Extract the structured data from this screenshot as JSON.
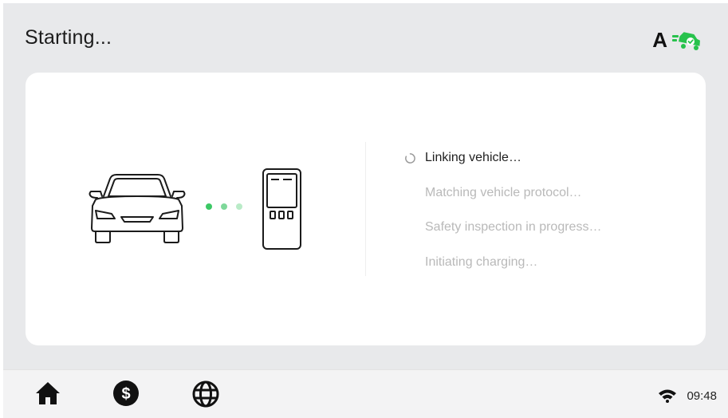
{
  "header": {
    "title": "Starting...",
    "brand_letter": "A",
    "brand_icon": "charging-car-check-icon",
    "brand_color": "#27c24c"
  },
  "connection": {
    "vehicle_icon": "car-icon",
    "charger_icon": "charging-station-icon",
    "dot_colors": [
      "#3cc865",
      "#7ed89a",
      "#b9ebc7"
    ]
  },
  "steps": [
    {
      "label": "Linking vehicle…",
      "state": "active"
    },
    {
      "label": "Matching vehicle protocol…",
      "state": "pending"
    },
    {
      "label": "Safety inspection in progress…",
      "state": "pending"
    },
    {
      "label": "Initiating charging…",
      "state": "pending"
    }
  ],
  "nav": [
    {
      "icon": "home-icon"
    },
    {
      "icon": "dollar-icon"
    },
    {
      "icon": "globe-icon"
    }
  ],
  "status": {
    "wifi_icon": "wifi-icon",
    "time": "09:48"
  },
  "colors": {
    "accent_green": "#3cc865",
    "active_text": "#1f1f1f",
    "pending_text": "#b9b9b9"
  }
}
